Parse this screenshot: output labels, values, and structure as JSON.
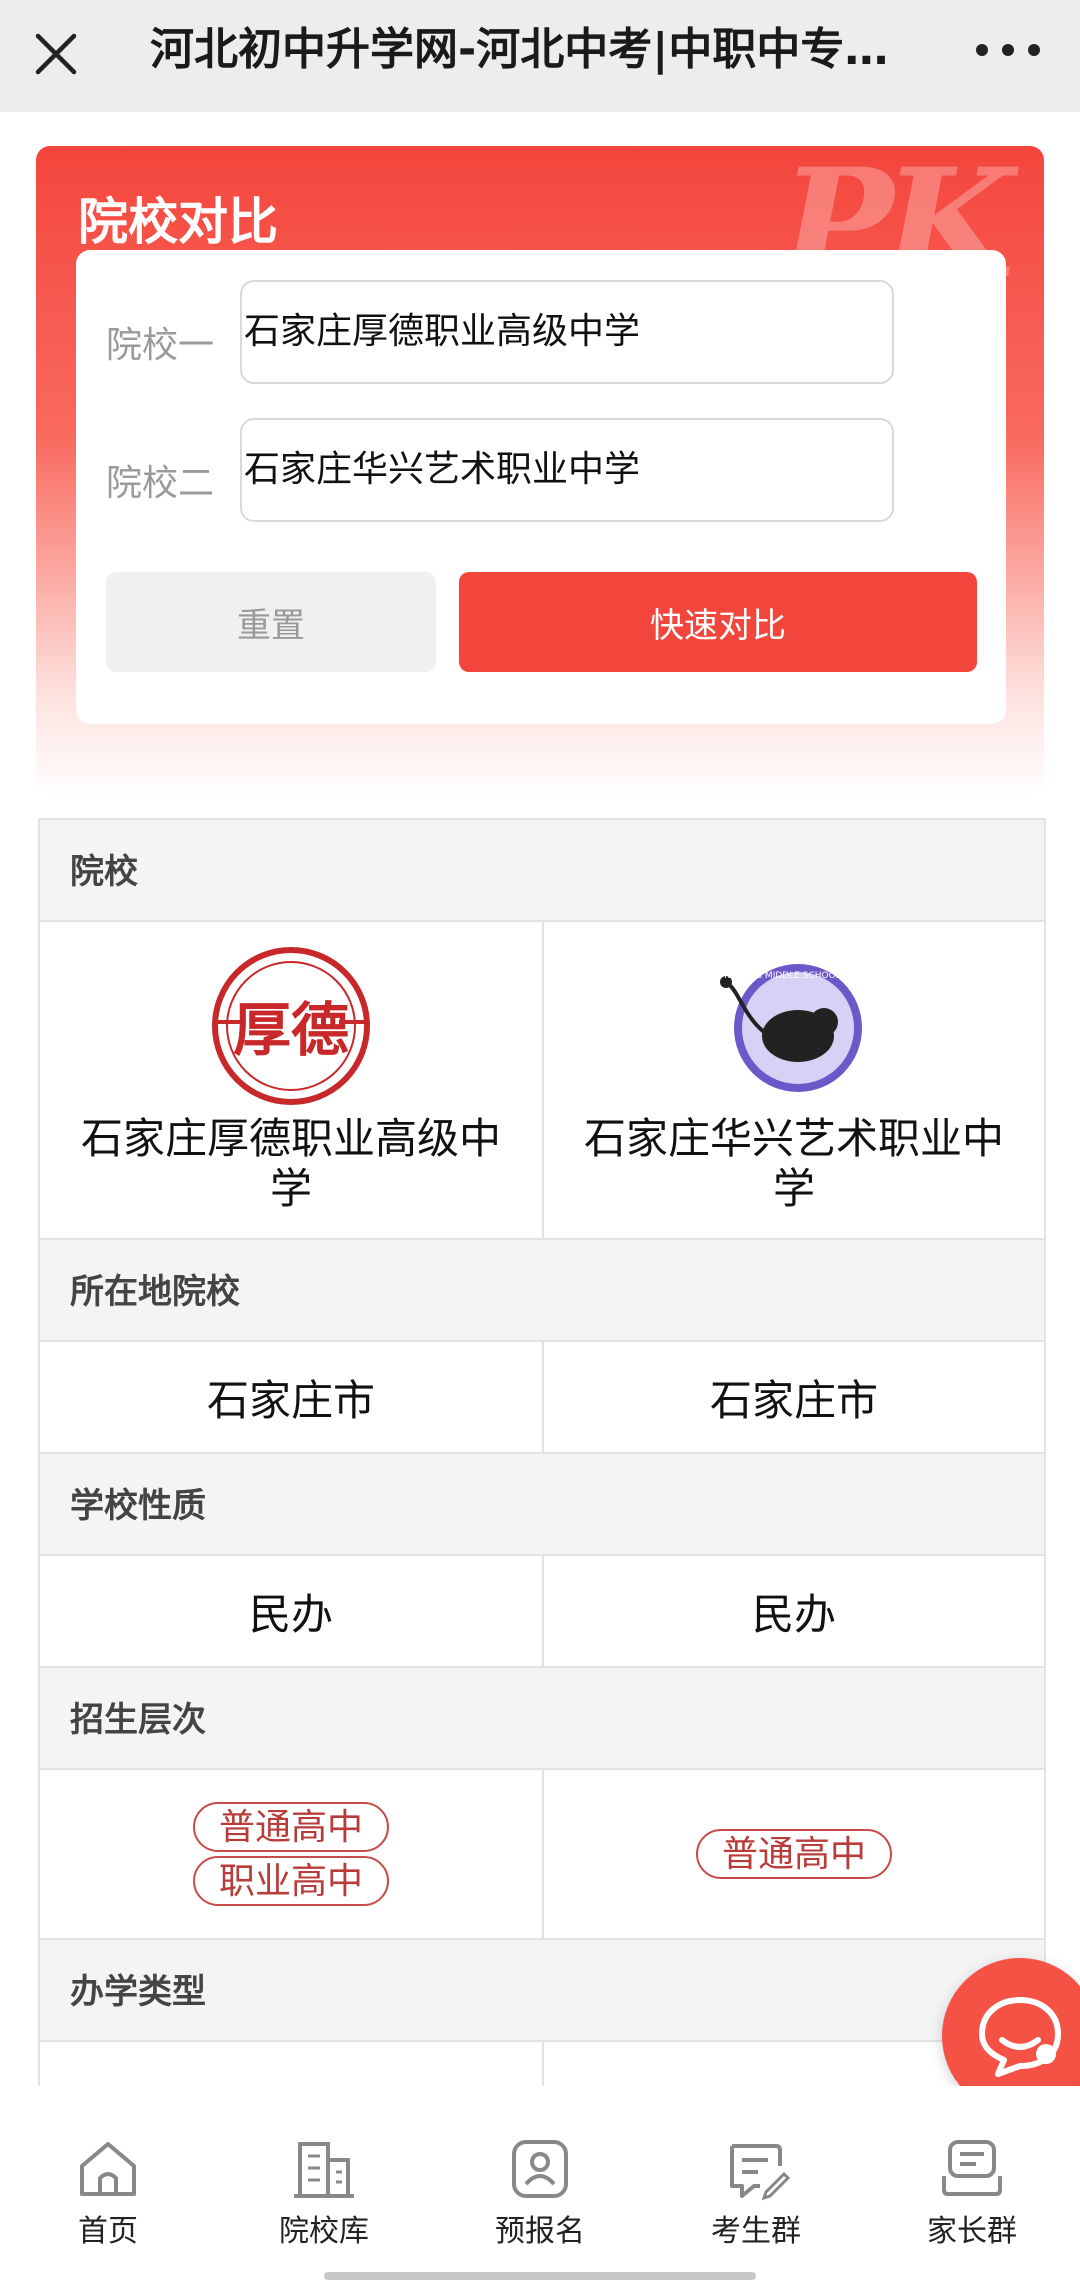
{
  "topbar": {
    "title": "河北初中升学网-河北中考|中职中专学校大全",
    "close_icon": "close-icon",
    "more_icon": "more-icon"
  },
  "compare": {
    "title": "院校对比",
    "watermark": "PK",
    "label_one": "院校一",
    "school_one": "石家庄厚德职业高级中学",
    "label_two": "院校二",
    "school_two": "石家庄华兴艺术职业中学",
    "reset_label": "重置",
    "compare_label": "快速对比",
    "accent": "#f2463c"
  },
  "table": {
    "school_header": "院校",
    "schools": [
      {
        "name": "石家庄厚德职业高级中学",
        "logo_text": "厚德"
      },
      {
        "name": "石家庄华兴艺术职业中学",
        "logo_text": "HUAXING MIDDLE SCHOOL OF ART"
      }
    ],
    "location_header": "所在地院校",
    "locations": [
      "石家庄市",
      "石家庄市"
    ],
    "nature_header": "学校性质",
    "natures": [
      "民办",
      "民办"
    ],
    "levels_header": "招生层次",
    "levels_left": [
      "普通高中",
      "职业高中"
    ],
    "levels_right": [
      "普通高中"
    ],
    "type_header": "办学类型"
  },
  "nav": {
    "items": [
      {
        "label": "首页",
        "icon": "home-icon"
      },
      {
        "label": "院校库",
        "icon": "school-building-icon"
      },
      {
        "label": "预报名",
        "icon": "user-badge-icon"
      },
      {
        "label": "考生群",
        "icon": "chat-edit-icon"
      },
      {
        "label": "家长群",
        "icon": "chat-group-icon"
      }
    ]
  }
}
